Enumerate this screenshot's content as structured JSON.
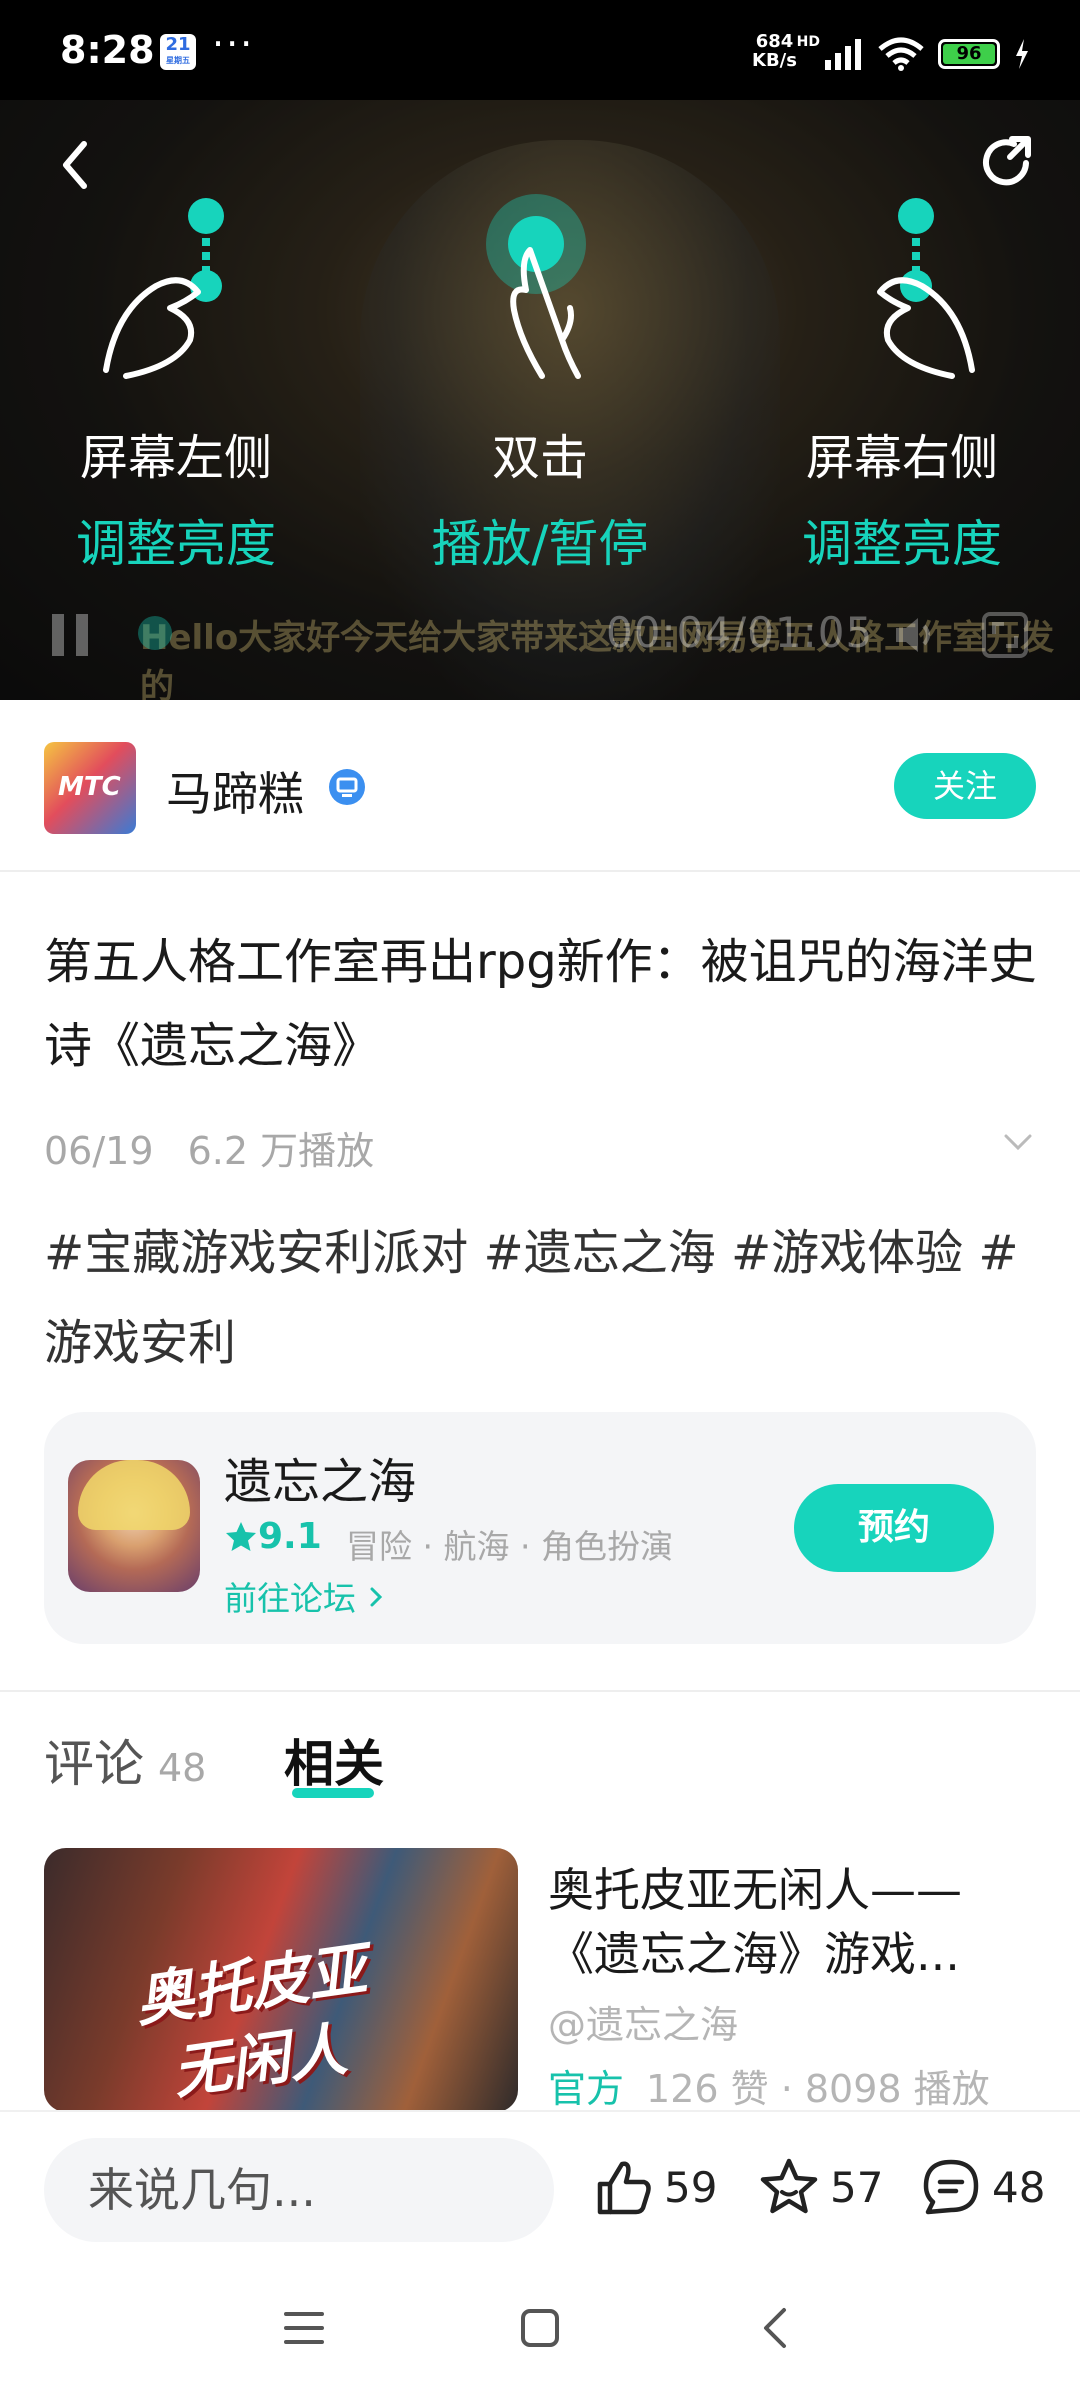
{
  "status_bar": {
    "time": "8:28",
    "calendar_day": "21",
    "calendar_label": "星期五",
    "more_dots": "···",
    "net_speed_value": "684",
    "net_speed_unit": "KB/s",
    "hd_label": "HD",
    "battery_level": "96"
  },
  "video": {
    "icons": {
      "back": "back-chevron-icon",
      "share": "share-icon"
    },
    "gestures": [
      {
        "title": "屏幕左侧",
        "action": "调整亮度"
      },
      {
        "title": "双击",
        "action": "播放/暂停"
      },
      {
        "title": "屏幕右侧",
        "action": "调整亮度"
      }
    ],
    "time_display": "00:04/01:05",
    "subtitle": "Hello大家好今天给大家带来这款由网易第五人格工作室开发的"
  },
  "author": {
    "avatar_text": "MTC",
    "name": "马蹄糕",
    "follow_label": "关注"
  },
  "post": {
    "title": "第五人格工作室再出rpg新作：被诅咒的海洋史诗《遗忘之海》",
    "date": "06/19",
    "plays": "6.2 万播放",
    "tags": "#宝藏游戏安利派对 #遗忘之海 #游戏体验 #游戏安利"
  },
  "game_card": {
    "name": "遗忘之海",
    "rating": "9.1",
    "genres": "冒险 · 航海 · 角色扮演",
    "forum_link": "前往论坛",
    "reserve_label": "预约",
    "accent": "#17d4bc"
  },
  "tabs": {
    "comments_label": "评论",
    "comments_count": "48",
    "related_label": "相关"
  },
  "related": {
    "thumb_text_1": "奥托皮亚",
    "thumb_text_2": "无闲人",
    "title": "奥托皮亚无闲人——《遗忘之海》游戏...",
    "channel": "@遗忘之海",
    "official": "官方",
    "stats": "126 赞 · 8098 播放"
  },
  "action_bar": {
    "comment_placeholder": "来说几句...",
    "likes": "59",
    "favorites": "57",
    "comments": "48"
  }
}
